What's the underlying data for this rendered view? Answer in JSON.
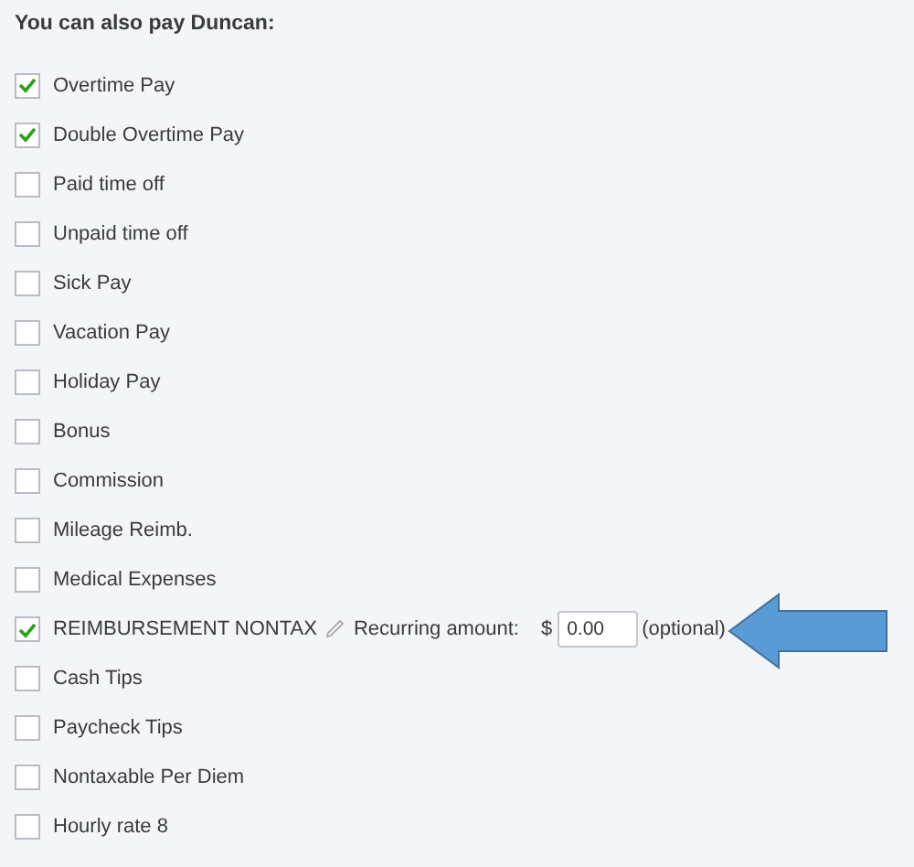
{
  "heading": "You can also pay Duncan:",
  "items": [
    {
      "label": "Overtime Pay",
      "checked": true
    },
    {
      "label": "Double Overtime Pay",
      "checked": true
    },
    {
      "label": "Paid time off",
      "checked": false
    },
    {
      "label": "Unpaid time off",
      "checked": false
    },
    {
      "label": "Sick Pay",
      "checked": false
    },
    {
      "label": "Vacation Pay",
      "checked": false
    },
    {
      "label": "Holiday Pay",
      "checked": false
    },
    {
      "label": "Bonus",
      "checked": false
    },
    {
      "label": "Commission",
      "checked": false
    },
    {
      "label": "Mileage Reimb.",
      "checked": false
    },
    {
      "label": "Medical Expenses",
      "checked": false
    },
    {
      "label": "REIMBURSEMENT NONTAX",
      "checked": true,
      "kind": "recurring",
      "amount_label": "Recurring amount:",
      "currency": "$",
      "value": "0.00",
      "note": "(optional)"
    },
    {
      "label": "Cash Tips",
      "checked": false
    },
    {
      "label": "Paycheck Tips",
      "checked": false
    },
    {
      "label": "Nontaxable Per Diem",
      "checked": false
    },
    {
      "label": "Hourly rate 8",
      "checked": false
    }
  ]
}
